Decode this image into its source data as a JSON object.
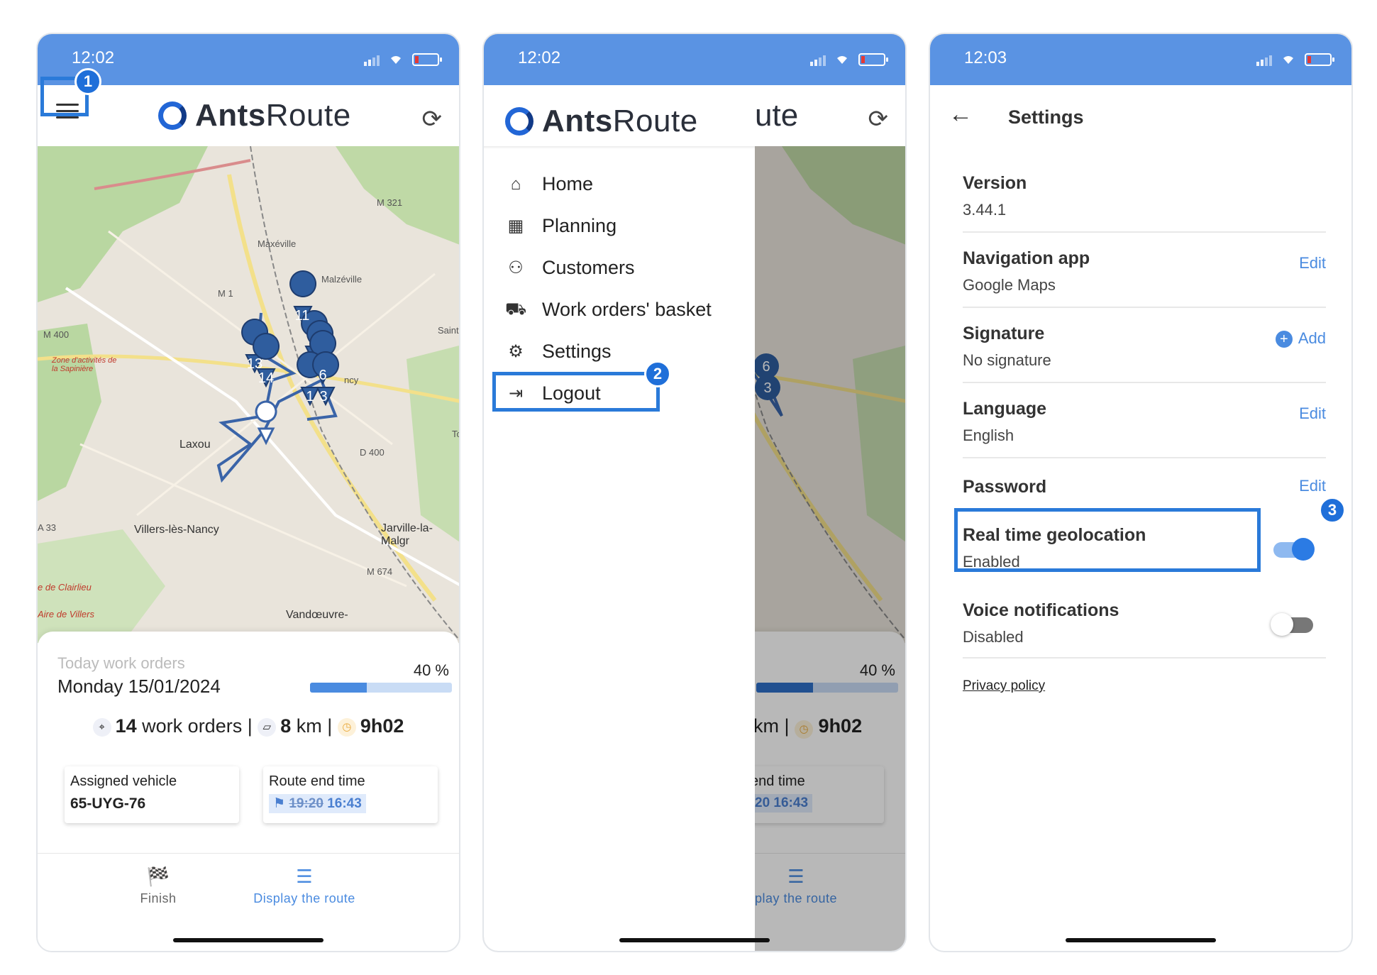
{
  "colors": {
    "accent": "#5a93e3",
    "highlight": "#2a7ad9",
    "link": "#4a8be0"
  },
  "phone1": {
    "status": {
      "time": "12:02"
    },
    "logo": {
      "bold": "Ants",
      "light": "Route"
    },
    "menu_badge": "1",
    "map": {
      "labels": [
        "Maxéville",
        "Malzéville",
        "M 321",
        "M 1",
        "M 400",
        "Zone d'activités de la Sapinière",
        "Laxou",
        "D 400",
        "Villers-lès-Nancy",
        "Jarville-la-Malgr",
        "M 674",
        "A 33",
        "e de Clairlieu",
        "Aire de Villers",
        "Vandœuvre-",
        "Saint-",
        "ncy",
        "To"
      ],
      "markers": [
        "11",
        "13",
        "14",
        "6",
        "1",
        "3"
      ]
    },
    "sheet": {
      "subtitle": "Today work orders",
      "date": "Monday 15/01/2024",
      "progress_label": "40 %",
      "progress": 0.4,
      "work_orders_num": "14",
      "work_orders_txt": "work orders |",
      "km_num": "8",
      "km_txt": "km |",
      "duration": "9h02",
      "vehicle_title": "Assigned vehicle",
      "vehicle_value": "65-UYG-76",
      "end_title": "Route end time",
      "end_old": "19:20",
      "end_new": "16:43",
      "tab_finish": "Finish",
      "tab_route": "Display the route"
    }
  },
  "phone2": {
    "status": {
      "time": "12:02"
    },
    "logo": {
      "bold": "Ants",
      "light": "Route"
    },
    "behind_title": "ute",
    "menu": [
      {
        "label": "Home",
        "icon": "home-icon"
      },
      {
        "label": "Planning",
        "icon": "calendar-icon"
      },
      {
        "label": "Customers",
        "icon": "customers-icon"
      },
      {
        "label": "Work orders' basket",
        "icon": "basket-icon"
      },
      {
        "label": "Settings",
        "icon": "gear-icon"
      },
      {
        "label": "Logout",
        "icon": "logout-icon"
      }
    ],
    "settings_badge": "2",
    "behind": {
      "pct": "40 %",
      "stats_tail": "km |",
      "duration": "9h02",
      "end_title": "end time",
      "end_value": "20 16:43",
      "tab_route": "play the route",
      "markers": [
        "6",
        "3"
      ]
    }
  },
  "phone3": {
    "status": {
      "time": "12:03"
    },
    "title": "Settings",
    "rows": {
      "version": {
        "label": "Version",
        "value": "3.44.1"
      },
      "nav": {
        "label": "Navigation app",
        "value": "Google Maps",
        "action": "Edit"
      },
      "signature": {
        "label": "Signature",
        "value": "No signature",
        "action": "Add"
      },
      "language": {
        "label": "Language",
        "value": "English",
        "action": "Edit"
      },
      "password": {
        "label": "Password",
        "action": "Edit"
      },
      "geo": {
        "label": "Real time geolocation",
        "value": "Enabled",
        "enabled": true
      },
      "voice": {
        "label": "Voice notifications",
        "value": "Disabled",
        "enabled": false
      }
    },
    "geo_badge": "3",
    "privacy": "Privacy policy"
  }
}
